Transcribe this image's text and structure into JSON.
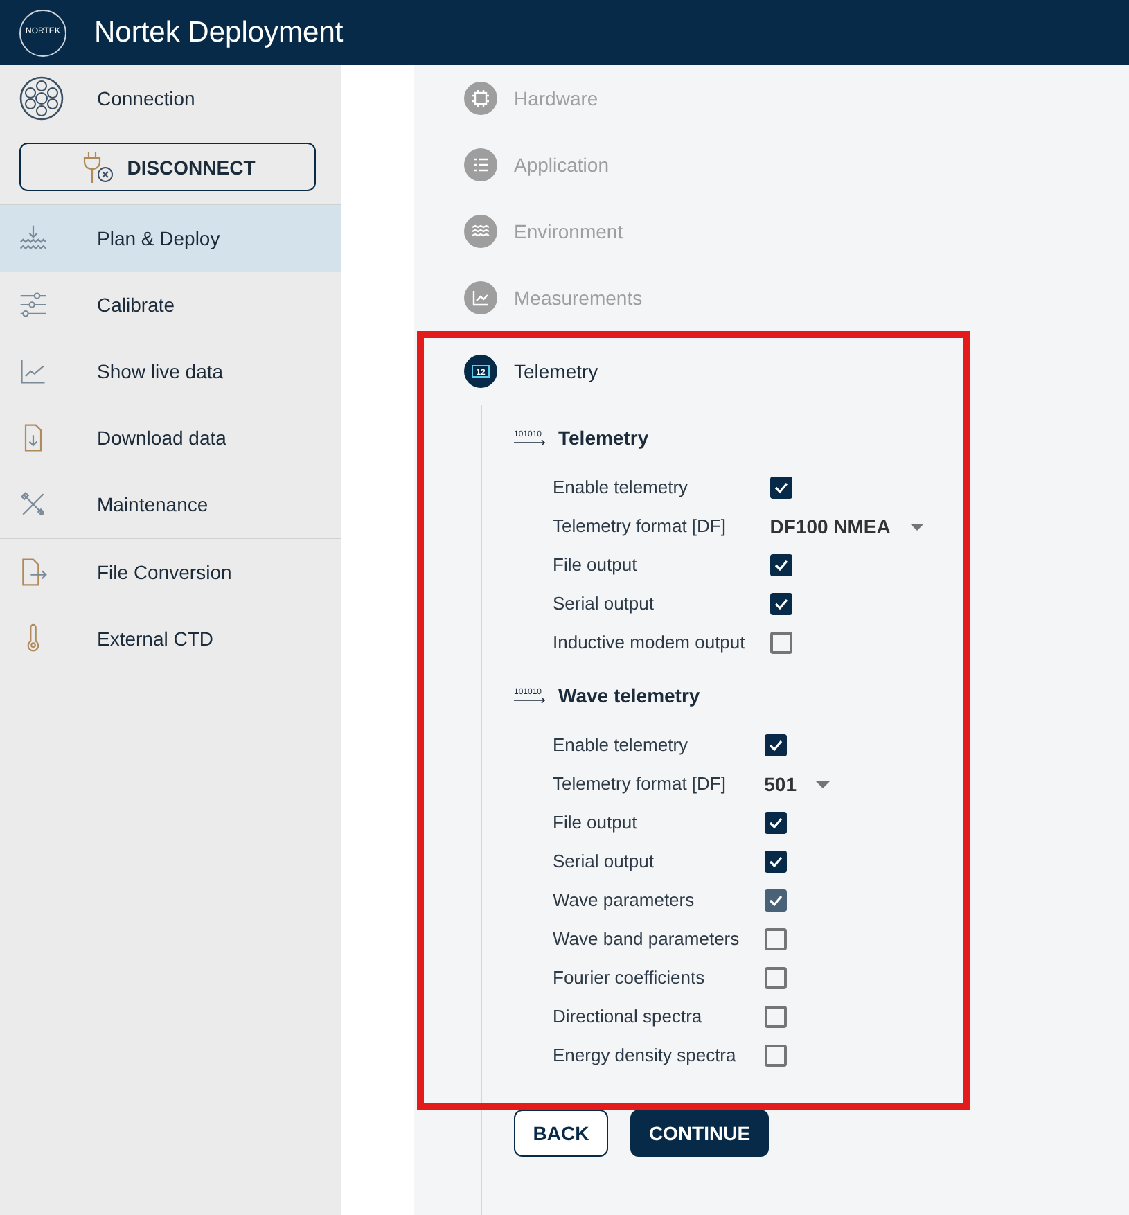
{
  "header": {
    "logo_text": "NORTEK",
    "title": "Nortek Deployment"
  },
  "sidebar": {
    "connection": {
      "label": "Connection"
    },
    "disconnect_button": "DISCONNECT",
    "groups": [
      [
        {
          "kind": "plan",
          "label": "Plan & Deploy",
          "selected": true
        },
        {
          "kind": "calibrate",
          "label": "Calibrate",
          "selected": false
        },
        {
          "kind": "live",
          "label": "Show live data",
          "selected": false
        },
        {
          "kind": "download",
          "label": "Download data",
          "selected": false
        },
        {
          "kind": "maintenance",
          "label": "Maintenance",
          "selected": false
        }
      ],
      [
        {
          "kind": "conversion",
          "label": "File Conversion",
          "selected": false
        },
        {
          "kind": "ctd",
          "label": "External CTD",
          "selected": false
        }
      ]
    ]
  },
  "steps": [
    {
      "kind": "hardware",
      "label": "Hardware",
      "selected": false
    },
    {
      "kind": "application",
      "label": "Application",
      "selected": false
    },
    {
      "kind": "environment",
      "label": "Environment",
      "selected": false
    },
    {
      "kind": "measurements",
      "label": "Measurements",
      "selected": false
    },
    {
      "kind": "telemetry",
      "label": "Telemetry",
      "selected": true,
      "highlighted": true,
      "icon_text": "12"
    }
  ],
  "sections": [
    {
      "icon_text": "101010",
      "title": "Telemetry",
      "rows": [
        {
          "kind": "checkbox",
          "label": "Enable telemetry",
          "checked": true,
          "disabled": false
        },
        {
          "kind": "select",
          "label": "Telemetry format [DF]",
          "value": "DF100 NMEA"
        },
        {
          "kind": "checkbox",
          "label": "File output",
          "checked": true,
          "disabled": false
        },
        {
          "kind": "checkbox",
          "label": "Serial output",
          "checked": true,
          "disabled": false
        },
        {
          "kind": "checkbox",
          "label": "Inductive modem output",
          "checked": false,
          "disabled": false
        }
      ]
    },
    {
      "icon_text": "101010",
      "title": "Wave telemetry",
      "rows": [
        {
          "kind": "checkbox",
          "label": "Enable telemetry",
          "checked": true,
          "disabled": false
        },
        {
          "kind": "select",
          "label": "Telemetry format [DF]",
          "value": "501"
        },
        {
          "kind": "checkbox",
          "label": "File output",
          "checked": true,
          "disabled": false
        },
        {
          "kind": "checkbox",
          "label": "Serial output",
          "checked": true,
          "disabled": false
        },
        {
          "kind": "checkbox",
          "label": "Wave parameters",
          "checked": true,
          "disabled": true
        },
        {
          "kind": "checkbox",
          "label": "Wave band parameters",
          "checked": false,
          "disabled": false
        },
        {
          "kind": "checkbox",
          "label": "Fourier coefficients",
          "checked": false,
          "disabled": false
        },
        {
          "kind": "checkbox",
          "label": "Directional spectra",
          "checked": false,
          "disabled": false
        },
        {
          "kind": "checkbox",
          "label": "Energy density spectra",
          "checked": false,
          "disabled": false
        }
      ]
    }
  ],
  "buttons": {
    "back": "BACK",
    "continue": "CONTINUE"
  }
}
